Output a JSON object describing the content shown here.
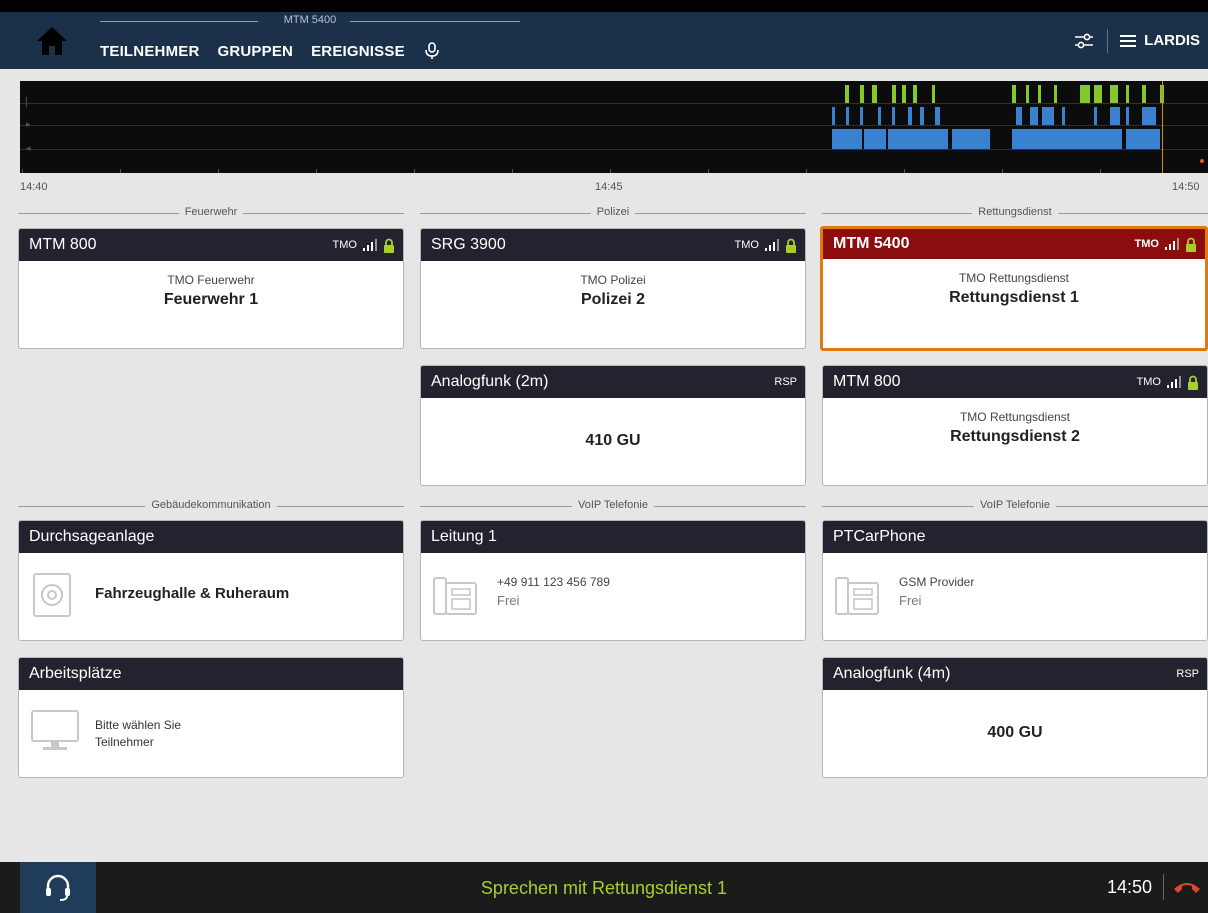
{
  "header": {
    "device_name": "MTM 5400",
    "nav": [
      "TEILNEHMER",
      "GRUPPEN",
      "EREIGNISSE"
    ],
    "menu_label": "LARDIS"
  },
  "timeline": {
    "labels": [
      "14:40",
      "14:45",
      "14:50"
    ]
  },
  "sections": {
    "feuerwehr": "Feuerwehr",
    "polizei": "Polizei",
    "rettungsdienst": "Rettungsdienst",
    "gebaeude": "Gebäudekommunikation",
    "voip1": "VoIP Telefonie",
    "voip2": "VoIP Telefonie"
  },
  "cards": {
    "mtm800_fw": {
      "title": "MTM 800",
      "net": "TMO",
      "sub": "TMO Feuerwehr",
      "main": "Feuerwehr 1"
    },
    "srg3900": {
      "title": "SRG 3900",
      "net": "TMO",
      "sub": "TMO Polizei",
      "main": "Polizei 2"
    },
    "mtm5400": {
      "title": "MTM 5400",
      "net": "TMO",
      "sub": "TMO Rettungsdienst",
      "main": "Rettungsdienst 1"
    },
    "analog2m": {
      "title": "Analogfunk (2m)",
      "net": "RSP",
      "main": "410 GU"
    },
    "mtm800_rd": {
      "title": "MTM 800",
      "net": "TMO",
      "sub": "TMO Rettungsdienst",
      "main": "Rettungsdienst 2"
    },
    "durchsage": {
      "title": "Durchsageanlage",
      "main": "Fahrzeughalle & Ruheraum"
    },
    "leitung1": {
      "title": "Leitung 1",
      "number": "+49 911 123 456 789",
      "status": "Frei"
    },
    "ptcar": {
      "title": "PTCarPhone",
      "number": "GSM Provider",
      "status": "Frei"
    },
    "arbeitsplaetze": {
      "title": "Arbeitsplätze",
      "line1": "Bitte wählen Sie",
      "line2": "Teilnehmer"
    },
    "analog4m": {
      "title": "Analogfunk (4m)",
      "net": "RSP",
      "main": "400 GU"
    }
  },
  "footer": {
    "speak": "Sprechen mit Rettungsdienst 1",
    "time": "14:50"
  },
  "colors": {
    "header": "#1b3049",
    "accent_green": "#a7cf2a",
    "active_red": "#8b0d0d",
    "selected_orange": "#e07a10",
    "tl_green": "#86c82c",
    "tl_blue": "#3a82d0"
  }
}
